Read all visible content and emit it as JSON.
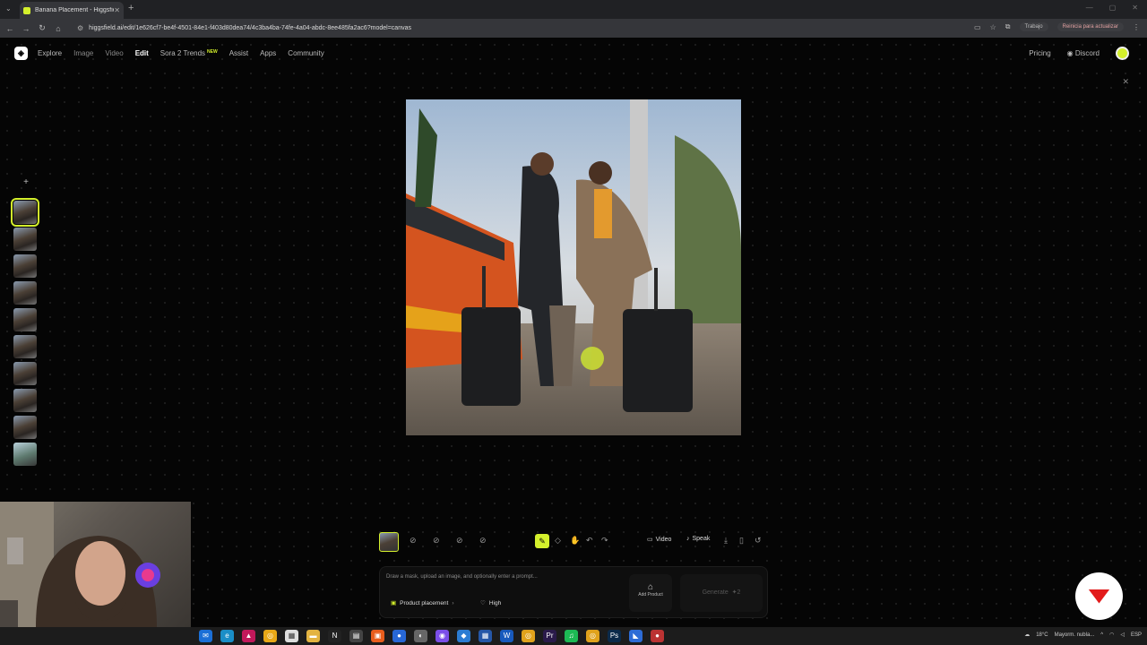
{
  "browser": {
    "tab_title": "Banana Placement - Higgsfield",
    "url": "higgsfield.ai/edit/1e626cf7-be4f-4501-84e1-f403d80dea74/4c3ba4ba-74fe-4a04-abdc-8ee485fa2ac6?model=canvas",
    "profile_label": "Trabajo",
    "update_label": "Reinicia para actualizar"
  },
  "nav": {
    "items": [
      "Explore",
      "Image",
      "Video",
      "Edit",
      "Sora 2 Trends",
      "Assist",
      "Apps",
      "Community"
    ],
    "active": "Edit",
    "new_badge": "NEW",
    "pricing": "Pricing",
    "discord": "Discord"
  },
  "toolbar": {
    "video_label": "Video",
    "speak_label": "Speak"
  },
  "prompt": {
    "placeholder": "Draw a mask, upload an image, and optionally enter a prompt...",
    "mode_label": "Product placement",
    "quality_label": "High",
    "add_product_label": "Add Product",
    "generate_label": "Generate",
    "generate_cost": "2"
  },
  "taskbar": {
    "weather": "18°C",
    "weather_desc": "Mayorm. nubla...",
    "lang": "ESP"
  },
  "colors": {
    "accent": "#d4f02c",
    "background": "#050505"
  }
}
